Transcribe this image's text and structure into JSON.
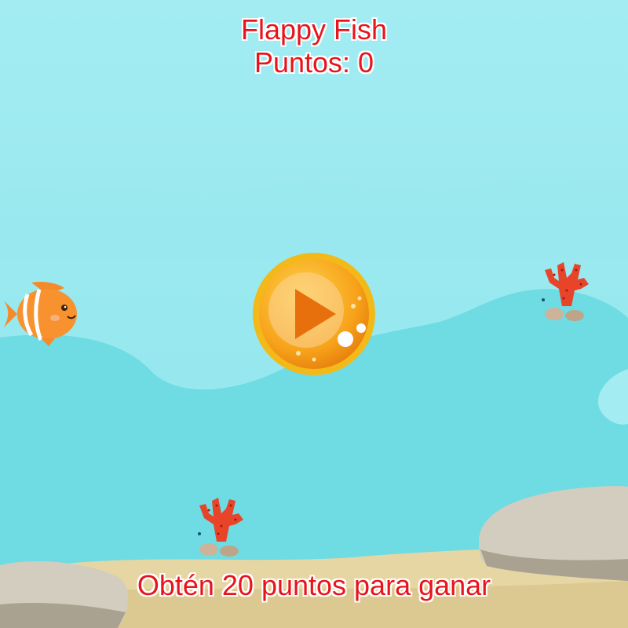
{
  "game": {
    "title": "Flappy Fish",
    "score_label": "Puntos: 0",
    "goal_text": "Obtén 20 puntos para ganar"
  },
  "icons": {
    "play": "play-icon",
    "player": "fish-icon",
    "obstacle": "coral-icon"
  },
  "colors": {
    "text": "#e8141c",
    "text_outline": "#ffffff",
    "water_light": "#a0ecf1",
    "water_mid": "#6fdbe2",
    "play_button": "#f7a21a"
  }
}
